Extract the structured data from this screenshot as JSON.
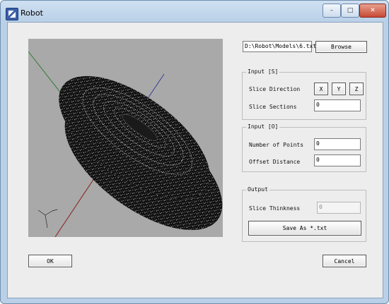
{
  "window": {
    "title": "Robot",
    "buttons": {
      "minimize": "–",
      "maximize": "□",
      "close": "✕"
    }
  },
  "file": {
    "path": "D:\\Robot\\Models\\6.txt",
    "browse_label": "Browse"
  },
  "input_s": {
    "title": "Input [S]",
    "slice_direction_label": "Slice Direction",
    "axis_buttons": [
      "X",
      "Y",
      "Z"
    ],
    "slice_sections_label": "Slice Sections",
    "slice_sections_value": "0"
  },
  "input_o": {
    "title": "Input [O]",
    "num_points_label": "Number of Points",
    "num_points_value": "0",
    "offset_distance_label": "Offset Distance",
    "offset_distance_value": "0"
  },
  "output": {
    "title": "Output",
    "slice_thickness_label": "Slice Thinkness",
    "slice_thickness_value": "0",
    "save_label": "Save As *.txt"
  },
  "footer": {
    "ok_label": "OK",
    "cancel_label": "Cancel"
  },
  "viewport": {
    "background": "#a9a9a9",
    "axis_colors": {
      "x": "#8b1f1f",
      "y": "#2e7a2e",
      "z": "#3c3c9c"
    }
  }
}
